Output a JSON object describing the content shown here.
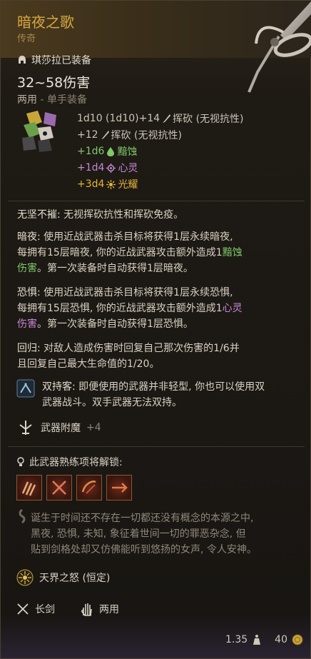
{
  "item": {
    "name": "暗夜之歌",
    "rarity": "传奇",
    "equipped_by": "琪莎拉已装备",
    "damage_range": "32~58伤害",
    "slot_main": "两用",
    "slot_sub": " - 单手装备"
  },
  "damage_rows": [
    {
      "text": "1d10 (1d10)+14",
      "icon": "slash-icon",
      "type": "挥砍 (无视抗性)",
      "color": "#cbc4b6"
    },
    {
      "text": "+12",
      "icon": "slash-icon",
      "type": "挥砍 (无视抗性)",
      "color": "#cbc4b6"
    },
    {
      "text": "+1d6",
      "icon": "acid-icon",
      "type": "黯蚀",
      "color": "#7fc96a"
    },
    {
      "text": "+1d4",
      "icon": "psychic-icon",
      "type": "心灵",
      "color": "#c686d6"
    },
    {
      "text": "+3d4",
      "icon": "radiant-icon",
      "type": "光耀",
      "color": "#e6b33a"
    }
  ],
  "passives": {
    "unyielding": {
      "name": "无坚不摧:",
      "text": " 无视挥砍抗性和挥砍免疫。"
    },
    "darkness": {
      "name": "暗夜:",
      "line1": " 使用近战武器击杀目标将获得1层永续暗夜,",
      "line2a": "每拥有15层暗夜, 你的近战武器攻击额外造成1",
      "line2b": "黯蚀",
      "line3a": "伤害",
      "line3b": "。第一次装备时自动获得1层暗夜。"
    },
    "fear": {
      "name": "恐惧:",
      "line1": " 使用近战武器击杀目标将获得1层永续恐惧,",
      "line2a": "每拥有15层恐惧, 你的近战武器攻击额外造成1",
      "line2b": "心灵",
      "line3a": "伤害",
      "line3b": "。第一次装备时自动获得1层恐惧。"
    },
    "return": {
      "name": "回归:",
      "line1": " 对敌人造成伤害时回复自己那次伤害的1/6并",
      "line2": "且回复自己最大生命值的1/20。"
    }
  },
  "dual_wielder": {
    "name": "双持客:",
    "line1": " 即便使用的武器并非轻型, 你也可以使用双",
    "line2": "武器战斗。双手武器无法双持。"
  },
  "enchant": {
    "label": "武器附魔",
    "value": "+4"
  },
  "mastery": {
    "label": "此武器熟练项将解锁:"
  },
  "lore": {
    "line1": "诞生于时间还不存在一切都还没有概念的本源之中,",
    "line2": "黑夜, 恐惧, 未知, 象征着世间一切的罪恶杂念, 但",
    "line3": "贴到剑格处却又仿佛能听到悠扬的女声, 令人安神。"
  },
  "spell": {
    "name": "天界之怒 (恒定)"
  },
  "properties": [
    {
      "label": "长剑",
      "icon": "longsword-icon"
    },
    {
      "label": "两用",
      "icon": "hand-icon"
    }
  ],
  "footer": {
    "weight": "1.35",
    "value": "40"
  },
  "colors": {
    "title": "#d8a83f",
    "acid": "#7fc96a",
    "psychic": "#c686d6",
    "radiant": "#e6b33a"
  }
}
